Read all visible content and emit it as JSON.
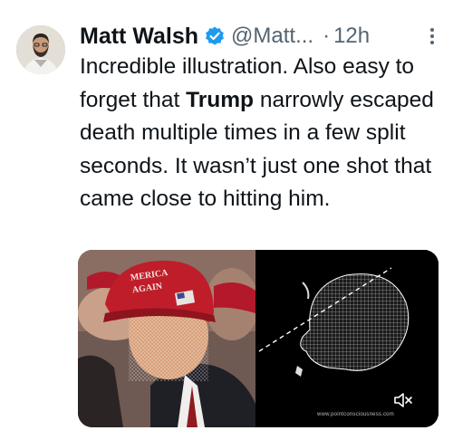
{
  "tweet": {
    "author_name": "Matt Walsh",
    "handle": "@Matt...",
    "separator": "·",
    "time": "12h",
    "text_before": "Incredible illustration. Also easy to forget that ",
    "text_bold": "Trump",
    "text_after": " narrowly escaped death multiple times in a few split seconds. It wasn’t just one shot that came close to hitting him."
  },
  "media": {
    "hat_text_line1": "MERICA",
    "hat_text_line2": "AGAIN",
    "watermark": "www.pointconsciousness.com"
  },
  "colors": {
    "text": "#0f1419",
    "secondary": "#536471",
    "verified": "#1d9bf0",
    "hat": "#c01d2a"
  },
  "icons": {
    "verified": "verified-badge-icon",
    "more": "more-options-icon",
    "mute": "speaker-muted-icon"
  }
}
